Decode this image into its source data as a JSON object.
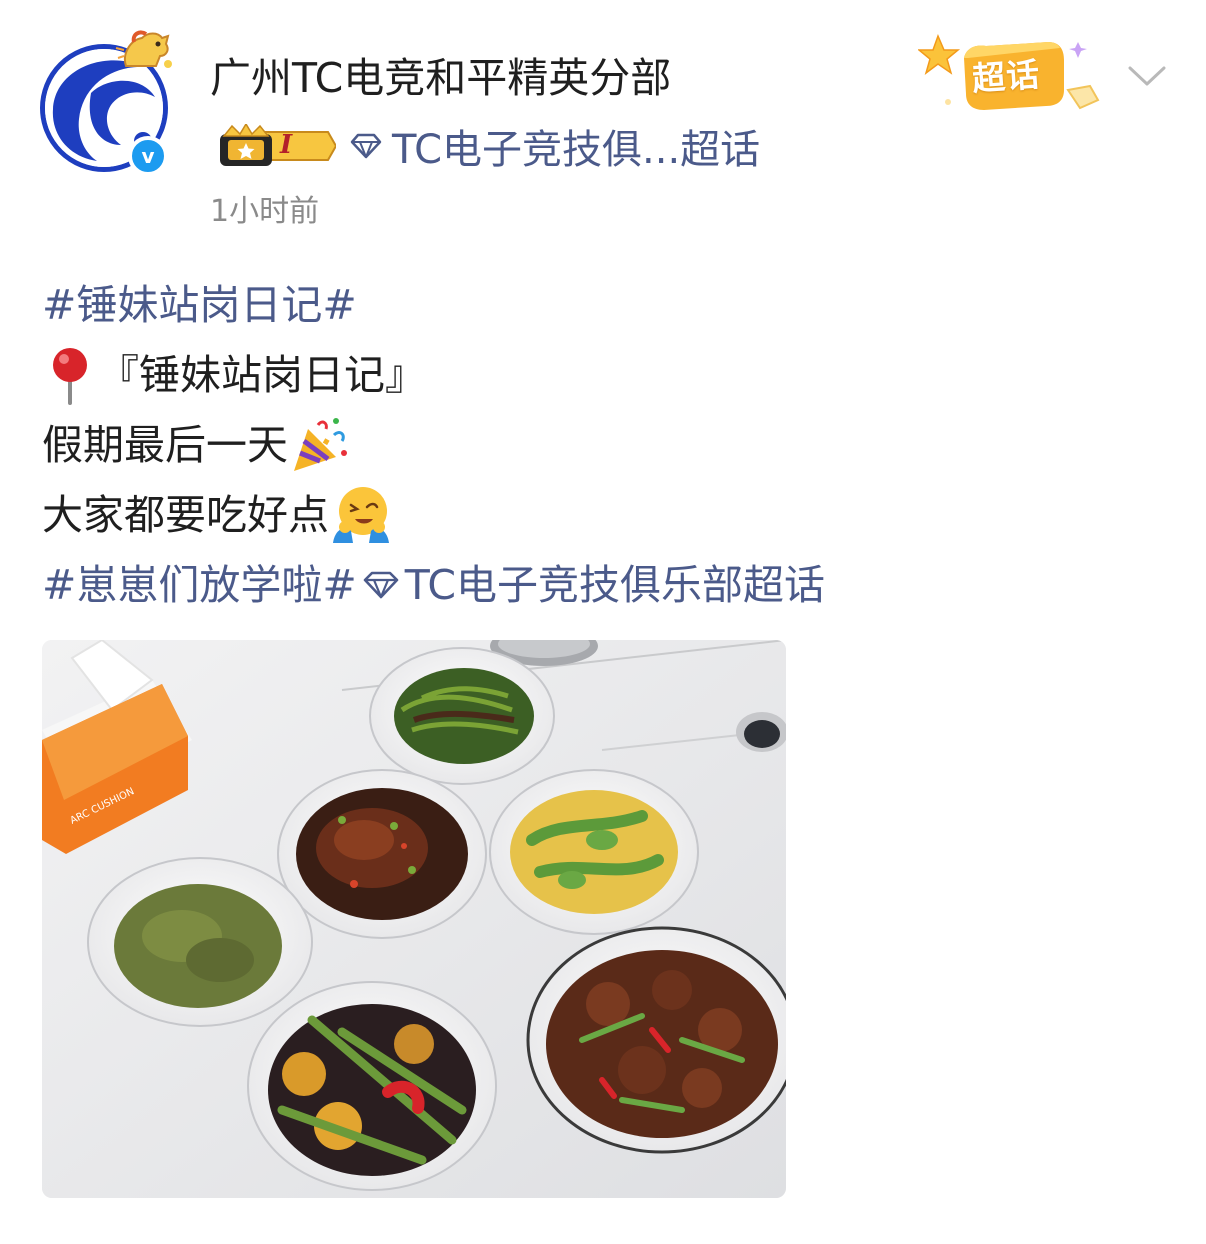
{
  "post": {
    "author": {
      "name": "广州TC电竞和平精英分部",
      "verified": true,
      "level_badge": "I",
      "supertopic_source": "TC电子竞技俱...超话",
      "avatar_text": "C"
    },
    "timestamp": "1小时前",
    "supertopic_button": "超话",
    "content": {
      "hashtag_1": "#锤妹站岗日记#",
      "title_line": "『锤妹站岗日记』",
      "line_2": "假期最后一天",
      "line_3": "大家都要吃好点",
      "hashtag_2": "#崽崽们放学啦#",
      "supertopic_tag": "TC电子竞技俱乐部超话"
    },
    "photo": {
      "tissue_box_text": "ARC CUSHION"
    },
    "colors": {
      "link": "#4b5a8a",
      "text": "#1f1f1f",
      "timestamp": "#8a8a8a",
      "avatar_ring": "#1e3ebf",
      "verified": "#1c9bf0",
      "supertopic_gold": "#f7b42c"
    },
    "icons": {
      "pin": "round-pushpin-emoji",
      "party": "party-popper-emoji",
      "wink": "wink-hug-emoji",
      "diamond": "supertopic-diamond-icon",
      "menu": "chevron-down-icon"
    }
  }
}
